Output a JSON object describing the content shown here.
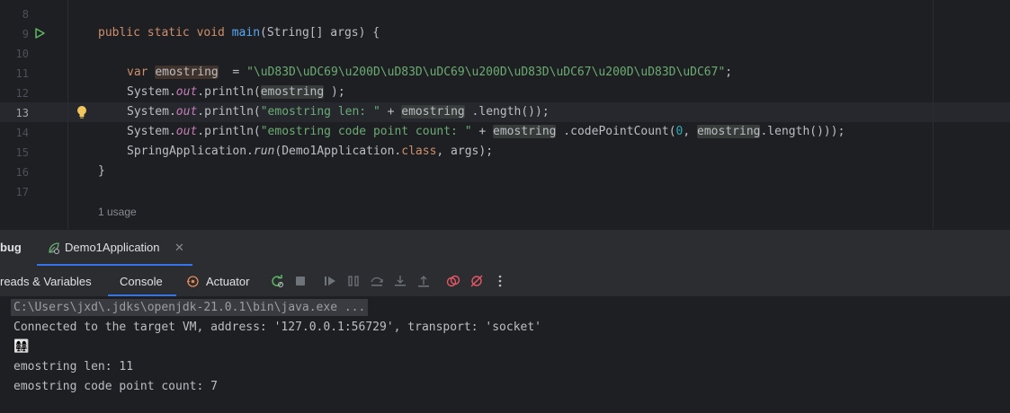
{
  "editor": {
    "line_numbers": [
      "8",
      "9",
      "10",
      "11",
      "12",
      "13",
      "14",
      "15",
      "16",
      "17"
    ],
    "code": {
      "main_sig": {
        "kw": "public static void ",
        "name": "main",
        "params": "(String[] args) {"
      },
      "var_decl": {
        "kw": "var ",
        "name": "emostring",
        "eq": "  = ",
        "value": "\"\\uD83D\\uDC69\\u200D\\uD83D\\uDC69\\u200D\\uD83D\\uDC67\\u200D\\uD83D\\uDC67\"",
        "end": ";"
      },
      "println1": {
        "a": "System.",
        "out": "out",
        "b": ".println(",
        "v": "emostring",
        "c": " );"
      },
      "println2": {
        "a": "System.",
        "out": "out",
        "b": ".println(",
        "s": "\"emostring len: \"",
        "plus": " + ",
        "v": "emostring",
        "c": " .length());"
      },
      "println3": {
        "a": "System.",
        "out": "out",
        "b": ".println(",
        "s": "\"emostring code point count: \"",
        "plus": " + ",
        "v": "emostring",
        "c": " .codePointCount(",
        "zero": "0",
        "comma": ", ",
        "v2": "emostring",
        "d": ".length()));"
      },
      "spring": {
        "a": "SpringApplication.",
        "run": "run",
        "b": "(Demo1Application.",
        "cls": "class",
        "c": ", args);"
      },
      "close": "}"
    },
    "usage_hint": "1 usage"
  },
  "debug": {
    "panel_title": "bug",
    "session_tab": "Demo1Application",
    "tabs": [
      "reads & Variables",
      "Console",
      "Actuator"
    ]
  },
  "console": {
    "lines": [
      "C:\\Users\\jxd\\.jdks\\openjdk-21.0.1\\bin\\java.exe ...",
      "Connected to the target VM, address: '127.0.0.1:56729', transport: 'socket'",
      "👩‍👩‍👧‍👧",
      "emostring len: 11",
      "emostring code point count: 7"
    ]
  },
  "colors": {
    "editor_bg": "#1e1f22",
    "panel_bg": "#2b2d30",
    "keyword": "#cf8e6d",
    "function": "#56a8f5",
    "string": "#6aab73",
    "static": "#c77dbb",
    "accent": "#3574f0"
  }
}
